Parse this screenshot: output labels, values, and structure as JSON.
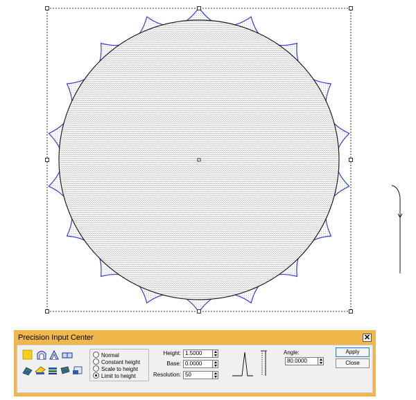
{
  "panel": {
    "title": "Precision Input Center",
    "close_glyph": "✕",
    "tools": [
      {
        "icon": "yellow-square-icon"
      },
      {
        "icon": "arch-shape-icon"
      },
      {
        "icon": "peak-shape-icon"
      },
      {
        "icon": "double-box-icon"
      },
      {
        "icon": "stack-tool-1-icon"
      },
      {
        "icon": "stack-tool-2-icon"
      },
      {
        "icon": "stack-tool-3-icon"
      },
      {
        "icon": "stack-tool-4-icon"
      },
      {
        "icon": "stack-tool-5-icon"
      }
    ],
    "modes": [
      {
        "label": "Normal",
        "selected": false
      },
      {
        "label": "Constant height",
        "selected": false
      },
      {
        "label": "Scale to height",
        "selected": false
      },
      {
        "label": "Limit to height",
        "selected": true
      }
    ],
    "fields": {
      "height": {
        "label": "Height:",
        "value": "1.5000"
      },
      "base": {
        "label": "Base:",
        "value": "0.0000"
      },
      "resolution": {
        "label": "Resolution:",
        "value": "50"
      },
      "angle": {
        "label": "Angle:",
        "value": "80.0000"
      }
    },
    "buttons": {
      "apply": "Apply",
      "close": "Close"
    }
  },
  "colors": {
    "panel_frame": "#f0b84a",
    "scallop_outline": "#3341d6",
    "circle_outline": "#1a1a1a",
    "hatch": "#9a9a9a"
  }
}
